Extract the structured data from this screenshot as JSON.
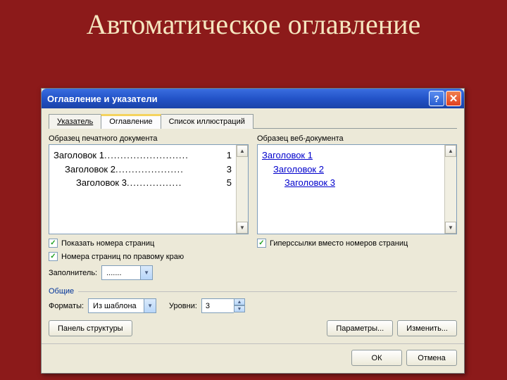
{
  "slide": {
    "title": "Автоматическое оглавление"
  },
  "dialog": {
    "title": "Оглавление и указатели",
    "tabs": {
      "index": "Указатель",
      "toc": "Оглавление",
      "figs": "Список иллюстраций"
    },
    "preview": {
      "print_label": "Образец печатного документа",
      "web_label": "Образец веб-документа",
      "h1": "Заголовок 1",
      "p1": "1",
      "h2": "Заголовок 2",
      "p2": "3",
      "h3": "Заголовок 3",
      "p3": "5"
    },
    "opts": {
      "show_pages": "Показать номера страниц",
      "right_align": "Номера страниц по правому краю",
      "hyperlinks": "Гиперссылки вместо номеров страниц",
      "leader_label": "Заполнитель:",
      "leader_value": "......."
    },
    "general": {
      "label": "Общие",
      "formats_label": "Форматы:",
      "formats_value": "Из шаблона",
      "levels_label": "Уровни:",
      "levels_value": "3"
    },
    "btns": {
      "outline": "Панель структуры",
      "params": "Параметры...",
      "modify": "Изменить...",
      "ok": "ОК",
      "cancel": "Отмена"
    }
  }
}
